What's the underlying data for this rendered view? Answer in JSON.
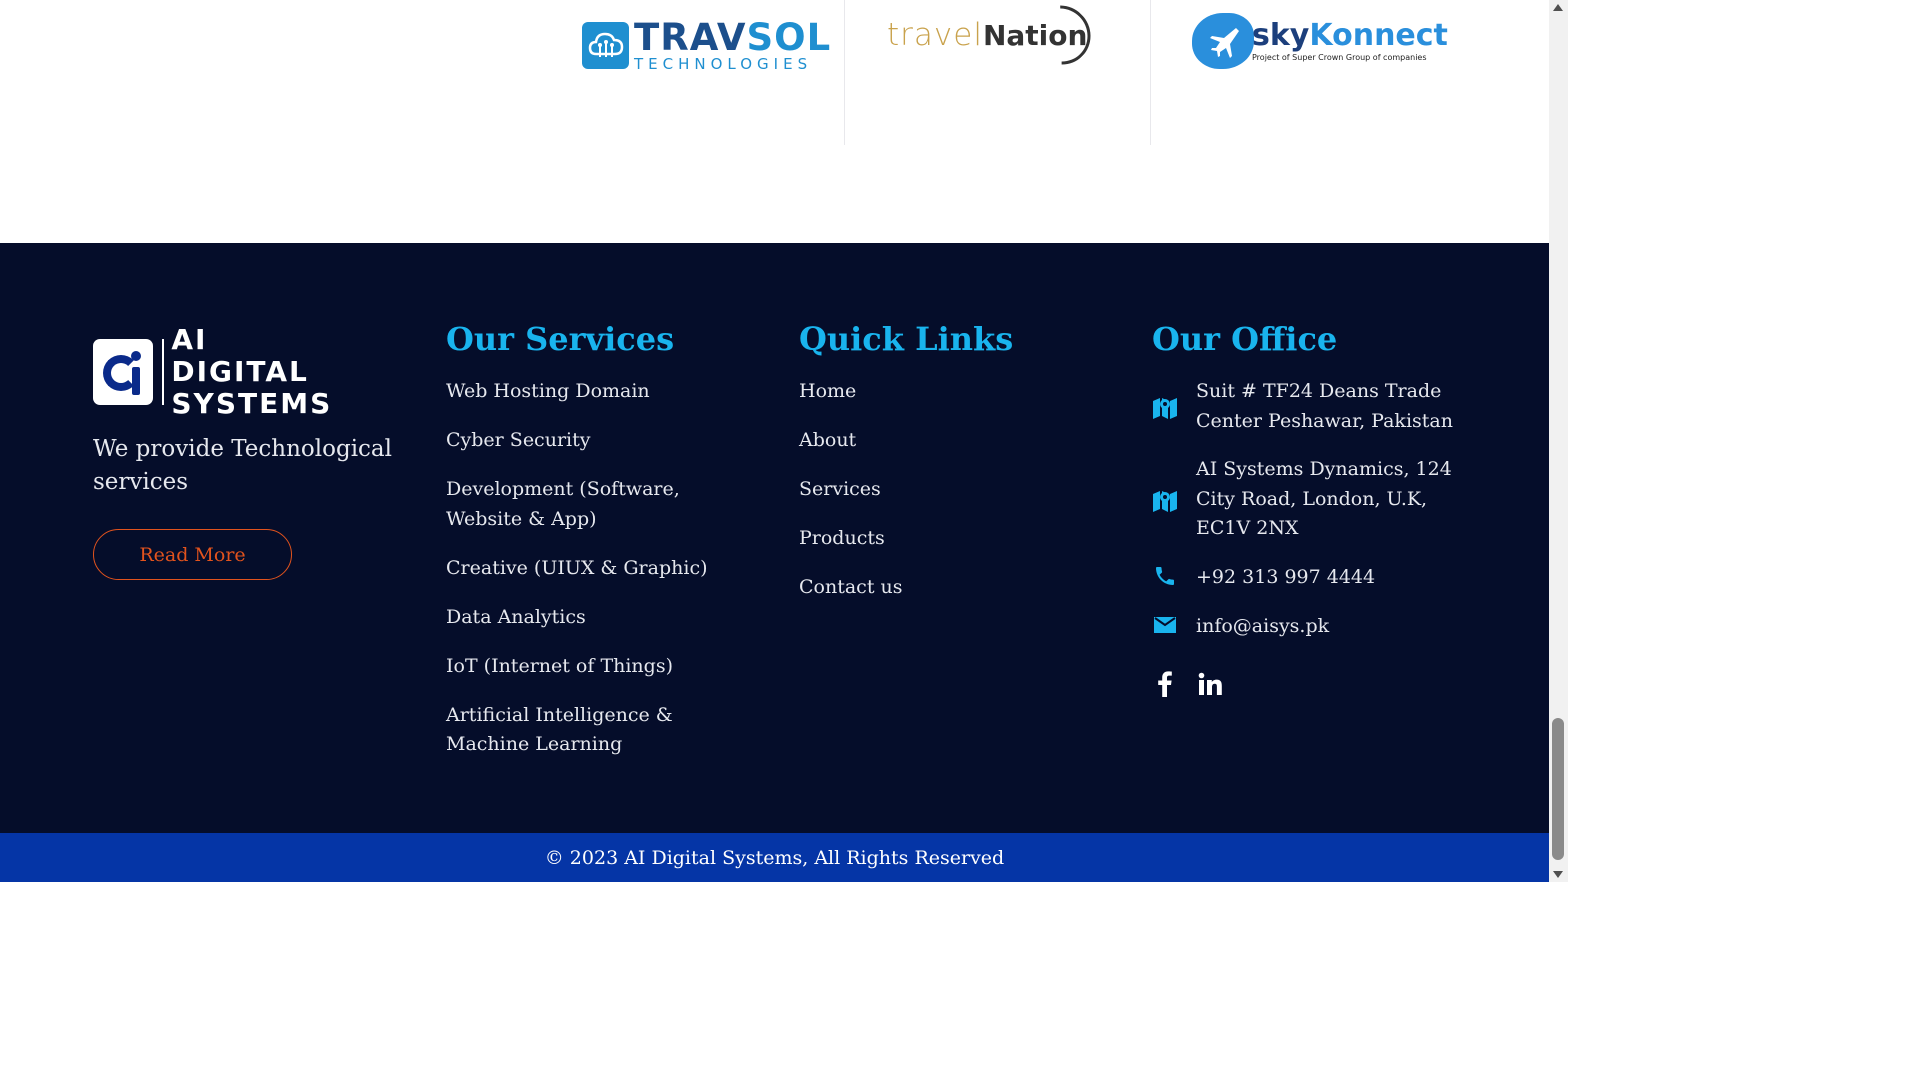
{
  "partners": [
    {
      "name": "TRAVSOL",
      "name_a": "TRAV",
      "name_b": "SOL",
      "subtitle": "TECHNOLOGIES"
    },
    {
      "name_a": "travel",
      "name_b": "Nation"
    },
    {
      "name_a": "sky",
      "name_b": "Konnect",
      "subtitle": "Project of Super Crown Group of companies"
    }
  ],
  "brand": {
    "name_line1": "AI DIGITAL",
    "name_line2": "SYSTEMS",
    "tagline": "We provide Technological services",
    "read_more": "Read More"
  },
  "services": {
    "title": "Our Services",
    "items": [
      "Web Hosting Domain",
      "Cyber Security",
      "Development (Software, Website & App)",
      "Creative (UIUX & Graphic)",
      "Data Analytics",
      "IoT (Internet of Things)",
      "Artificial Intelligence & Machine Learning"
    ]
  },
  "quick_links": {
    "title": "Quick Links",
    "items": [
      "Home",
      "About",
      "Services",
      "Products",
      "Contact us"
    ]
  },
  "office": {
    "title": "Our Office",
    "address1": "Suit # TF24 Deans Trade Center Peshawar, Pakistan",
    "address2": "AI Systems Dynamics, 124 City Road, London, U.K, EC1V 2NX",
    "phone": "+92 313 997 4444",
    "email": "info@aisys.pk",
    "social": [
      "facebook-icon",
      "linkedin-icon"
    ]
  },
  "copyright": "© 2023 AI Digital Systems, All Rights Reserved",
  "colors": {
    "footer_bg": "#050d2a",
    "accent_cyan": "#19b4ee",
    "accent_orange": "#e2531d",
    "copyright_bg": "#0535a6"
  }
}
